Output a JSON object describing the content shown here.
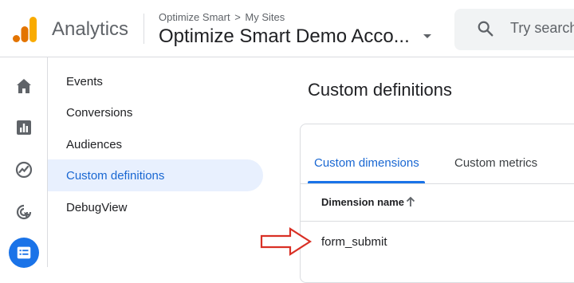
{
  "header": {
    "app_name": "Analytics",
    "breadcrumb": {
      "parent": "Optimize Smart",
      "separator": ">",
      "child": "My Sites"
    },
    "account_name": "Optimize Smart Demo Acco...",
    "search_placeholder": "Try search"
  },
  "rail": {
    "items": [
      {
        "icon": "home-icon",
        "active": false
      },
      {
        "icon": "reports-icon",
        "active": false
      },
      {
        "icon": "explore-icon",
        "active": false
      },
      {
        "icon": "advertising-icon",
        "active": false
      },
      {
        "icon": "configure-icon",
        "active": true
      }
    ]
  },
  "nav": {
    "items": [
      {
        "label": "Events",
        "active": false
      },
      {
        "label": "Conversions",
        "active": false
      },
      {
        "label": "Audiences",
        "active": false
      },
      {
        "label": "Custom definitions",
        "active": true
      },
      {
        "label": "DebugView",
        "active": false
      }
    ]
  },
  "main": {
    "title": "Custom definitions",
    "tabs": [
      {
        "label": "Custom dimensions",
        "active": true
      },
      {
        "label": "Custom metrics",
        "active": false
      }
    ],
    "table": {
      "columns": [
        "Dimension name"
      ],
      "rows": [
        [
          "form_submit"
        ]
      ]
    }
  },
  "colors": {
    "accent": "#1a73e8",
    "active_text": "#1967d2",
    "active_bg": "#e8f0fe",
    "annotation_arrow": "#d93025",
    "logo_orange": "#f9ab00",
    "logo_dark_orange": "#e37400"
  }
}
